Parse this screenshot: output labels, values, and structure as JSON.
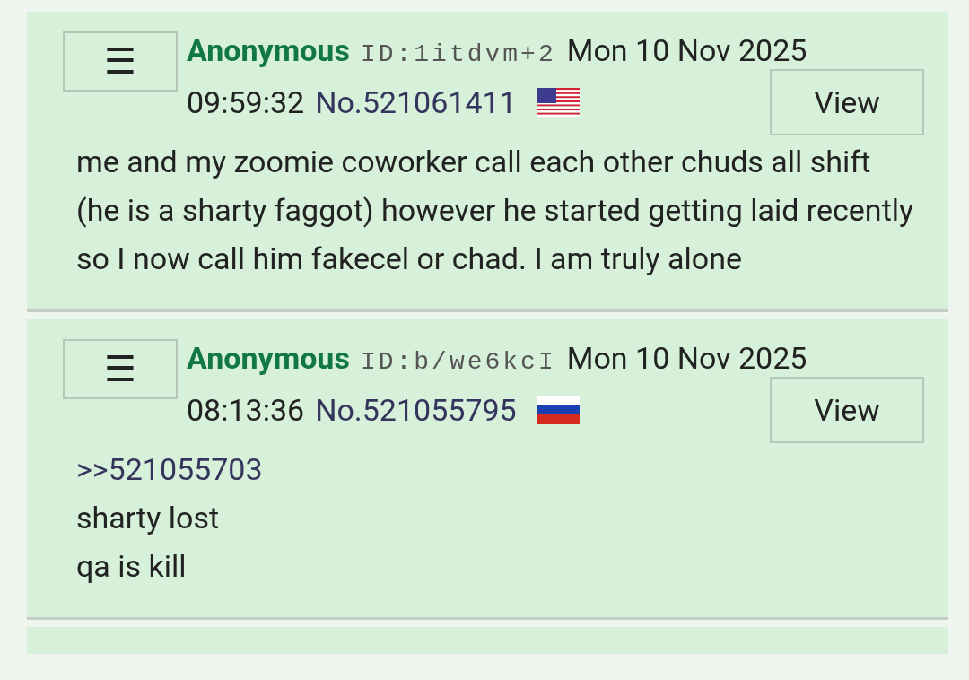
{
  "posts": [
    {
      "menu_button": "☰",
      "name": "Anonymous",
      "id": "ID:1itdvm+2",
      "date": "Mon 10 Nov 2025",
      "time": "09:59:32",
      "number": "No.521061411",
      "flag": {
        "kind": "stripes"
      },
      "view_button": "View",
      "body": [
        {
          "kind": "text",
          "text": "me and my zoomie coworker call each other chuds all shift (he is a sharty faggot) however he started getting laid recently so I now call him fakecel or chad. I am truly alone"
        }
      ]
    },
    {
      "menu_button": "☰",
      "name": "Anonymous",
      "id": "ID:b/we6kcI",
      "date": "Mon 10 Nov 2025",
      "time": "08:13:36",
      "number": "No.521055795",
      "flag": {
        "kind": "tricolor"
      },
      "view_button": "View",
      "body": [
        {
          "kind": "quote",
          "text": ">>521055703"
        },
        {
          "kind": "text",
          "text": "sharty lost"
        },
        {
          "kind": "text",
          "text": "qa is kill"
        }
      ]
    }
  ]
}
